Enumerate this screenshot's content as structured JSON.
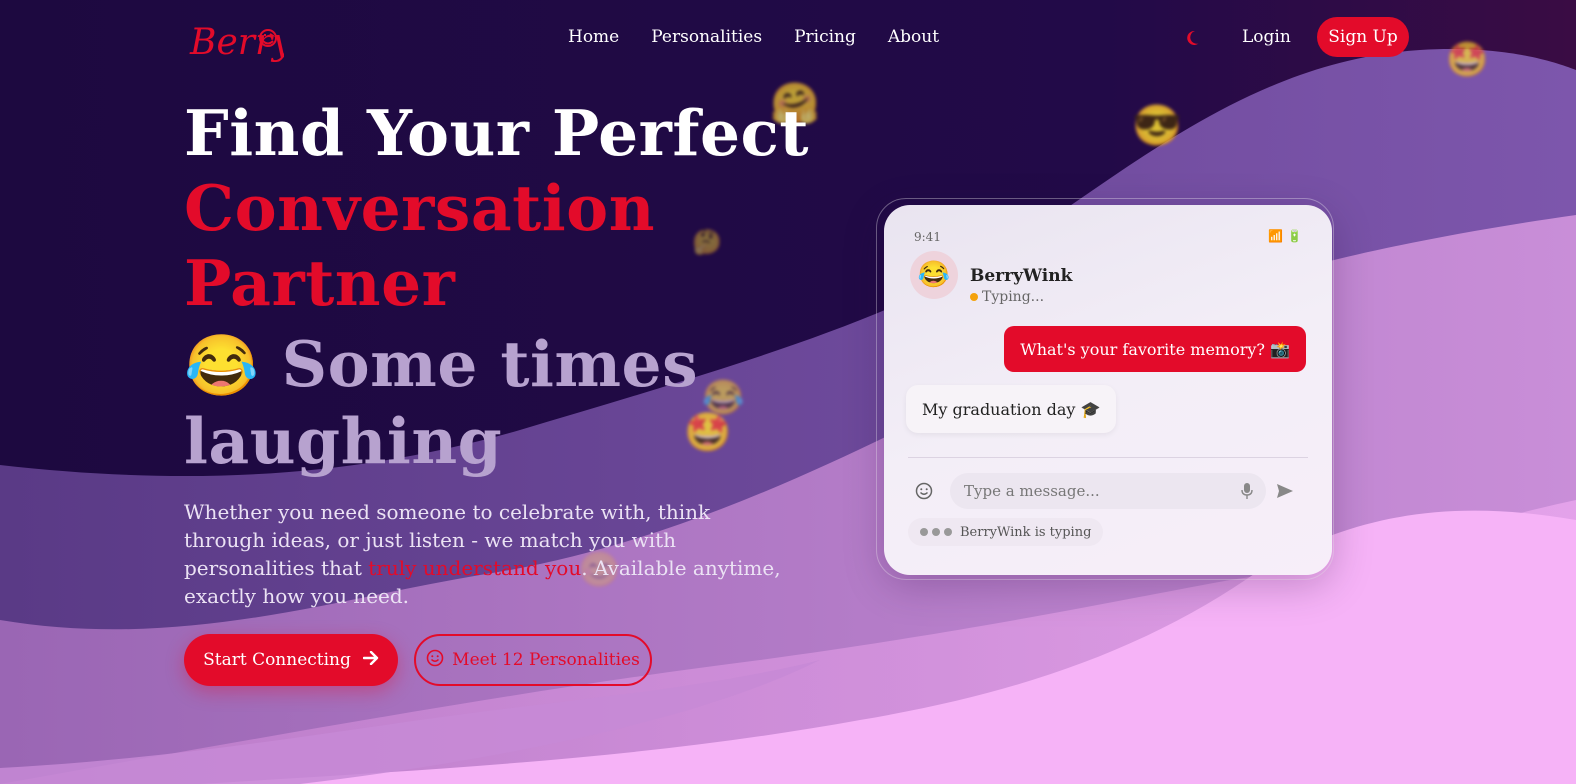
{
  "brand": {
    "logo_text": "Berry"
  },
  "nav": {
    "links": [
      "Home",
      "Personalities",
      "Pricing",
      "About"
    ],
    "theme_toggle_icon": "moon-icon",
    "login": "Login",
    "signup": "Sign Up"
  },
  "hero": {
    "line1": "Find Your Perfect",
    "line2": "Conversation",
    "line3": "Partner",
    "line4_emoji": "😂",
    "line4": "Some times",
    "line5": "laughing",
    "desc_part1": "Whether you need someone to celebrate with, think through ideas, or just listen - we match you with personalities that ",
    "desc_highlight": "truly understand you",
    "desc_part2": ". Available anytime, exactly how you need.",
    "cta_primary": "Start Connecting",
    "cta_secondary": "Meet 12 Personalities"
  },
  "chat": {
    "time": "9:41",
    "status_icons": "📶 🔋",
    "avatar_emoji": "😂",
    "bot_name": "BerryWink",
    "bot_status": "Typing...",
    "messages": [
      {
        "from": "user",
        "text": "What's your favorite memory? 📸"
      },
      {
        "from": "bot",
        "text": "My graduation day 🎓"
      }
    ],
    "input_placeholder": "Type a message...",
    "typing_indicator": "BerryWink is typing"
  },
  "floating_emojis": [
    "🤗",
    "😎",
    "🤩",
    "🤔",
    "😂",
    "🤩",
    "😊"
  ],
  "colors": {
    "accent": "#e30b2a",
    "background_dark": "#1e0a42",
    "wave_mid": "#8a5aa8",
    "wave_light": "#f6b3f7"
  }
}
